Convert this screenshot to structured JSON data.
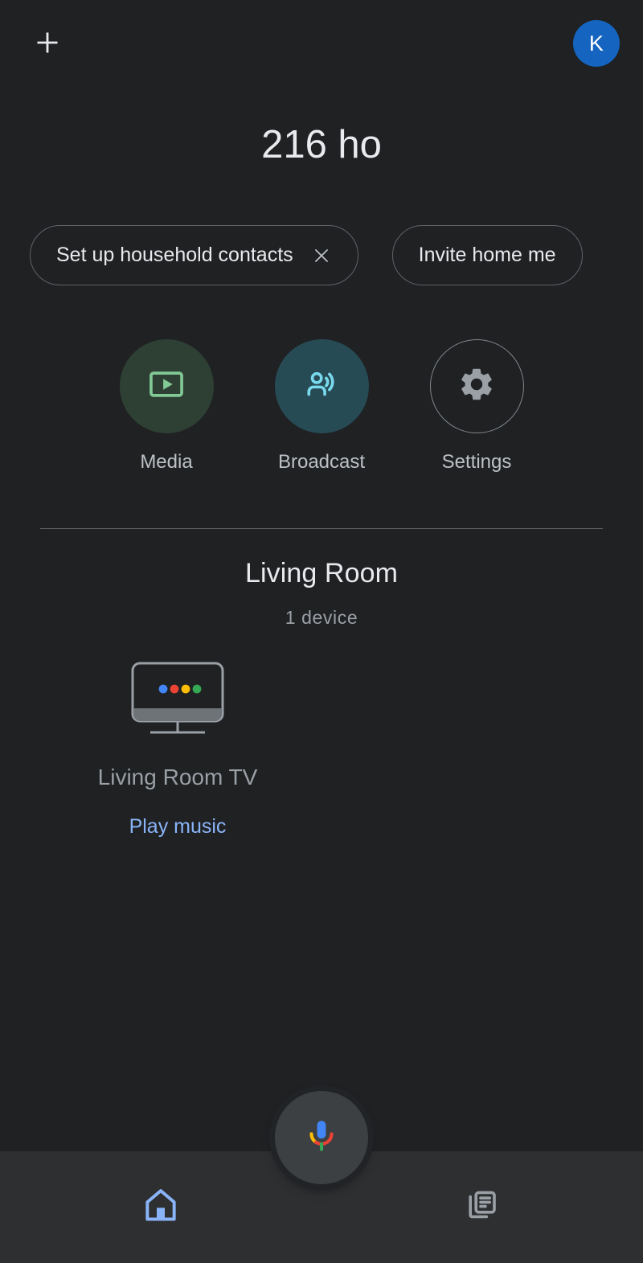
{
  "header": {
    "add_icon": "plus-icon",
    "title": "216 ho",
    "avatar_initial": "K",
    "avatar_color": "#1565c0"
  },
  "chips": [
    {
      "label": "Set up household contacts",
      "close_icon": "close-icon",
      "dismissible": true
    },
    {
      "label": "Invite home me",
      "dismissible": false
    }
  ],
  "quick_actions": [
    {
      "label": "Media",
      "icon": "media-play-icon",
      "circle_color": "#2e4034",
      "icon_color": "#81c995"
    },
    {
      "label": "Broadcast",
      "icon": "broadcast-icon",
      "circle_color": "#274b55",
      "icon_color": "#78d9ec"
    },
    {
      "label": "Settings",
      "icon": "gear-icon",
      "circle_color": "transparent",
      "icon_color": "#9aa0a6"
    }
  ],
  "room": {
    "name": "Living Room",
    "device_count_label": "1 device",
    "devices": [
      {
        "name": "Living Room TV",
        "icon": "tv-icon",
        "action_label": "Play music",
        "action_color": "#8ab4f8",
        "dot_colors": [
          "#4285f4",
          "#ea4335",
          "#fbbc04",
          "#34a853"
        ]
      }
    ]
  },
  "assistant_fab": {
    "icon": "google-assistant-mic-icon",
    "background": "#3c4043"
  },
  "bottom_nav": [
    {
      "icon": "home-icon",
      "active": true,
      "color": "#8ab4f8"
    },
    {
      "icon": "feed-icon",
      "active": false,
      "color": "#9aa0a6"
    }
  ]
}
